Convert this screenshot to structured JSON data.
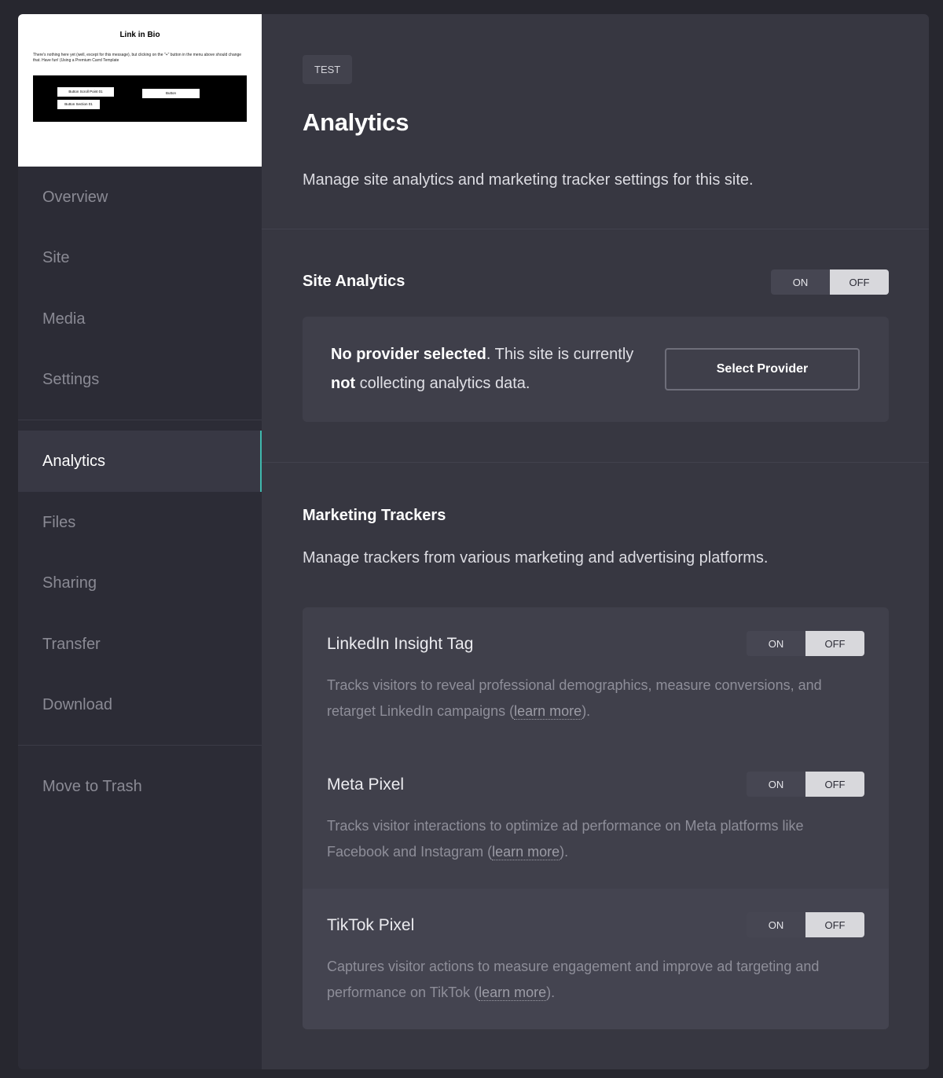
{
  "thumbnail": {
    "title": "Link in Bio",
    "text": "There's nothing here yet (well, except for this message), but clicking on the \"+\" button in the menu above should change that. Have fun! (Using a Premium Carrd Template",
    "button_scroll": "Button Scroll Point 01",
    "button_section": "Button Section 01",
    "button": "Button"
  },
  "sidebar": {
    "items": [
      {
        "label": "Overview"
      },
      {
        "label": "Site"
      },
      {
        "label": "Media"
      },
      {
        "label": "Settings"
      },
      {
        "label": "Analytics"
      },
      {
        "label": "Files"
      },
      {
        "label": "Sharing"
      },
      {
        "label": "Transfer"
      },
      {
        "label": "Download"
      },
      {
        "label": "Move to Trash"
      }
    ]
  },
  "header": {
    "badge": "TEST",
    "title": "Analytics",
    "description": "Manage site analytics and marketing tracker settings for this site."
  },
  "site_analytics": {
    "title": "Site Analytics",
    "toggle_on": "ON",
    "toggle_off": "OFF",
    "strong1": "No provider selected",
    "text1": ". This site is currently ",
    "strong2": "not",
    "text2": " collecting analytics data.",
    "button": "Select Provider"
  },
  "marketing": {
    "title": "Marketing Trackers",
    "description": "Manage trackers from various marketing and advertising platforms.",
    "trackers": [
      {
        "name": "LinkedIn Insight Tag",
        "desc": "Tracks visitors to reveal professional demographics, measure conversions, and retarget LinkedIn campaigns (",
        "learn": "learn more",
        "end": ").",
        "on": "ON",
        "off": "OFF"
      },
      {
        "name": "Meta Pixel",
        "desc": "Tracks visitor interactions to optimize ad performance on Meta platforms like Facebook and Instagram (",
        "learn": "learn more",
        "end": ").",
        "on": "ON",
        "off": "OFF"
      },
      {
        "name": "TikTok Pixel",
        "desc": "Captures visitor actions to measure engagement and improve ad targeting and performance on TikTok (",
        "learn": "learn more",
        "end": ").",
        "on": "ON",
        "off": "OFF"
      }
    ]
  },
  "colors": {
    "accent": "#3fb8ad",
    "background": "#27272f",
    "panel": "#373741",
    "sidebar": "#2c2c36"
  }
}
